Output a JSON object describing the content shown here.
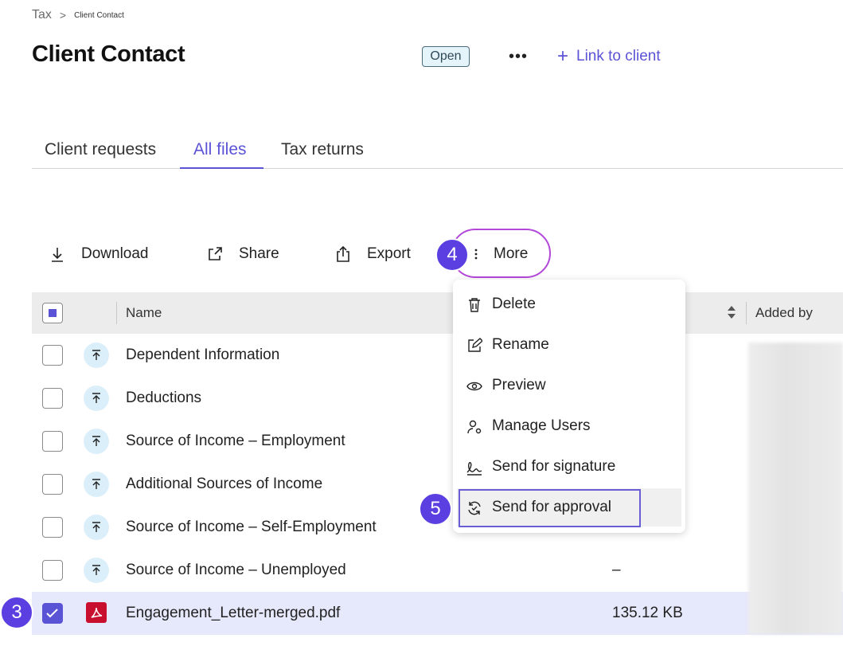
{
  "breadcrumb": {
    "root": "Tax",
    "separator": ">",
    "current": "Client Contact"
  },
  "page": {
    "title": "Client Contact",
    "status": "Open",
    "more_icon": "ellipsis-horizontal-icon",
    "link_label": "Link to client"
  },
  "tabs": [
    {
      "label": "Client requests",
      "active": false
    },
    {
      "label": "All files",
      "active": true
    },
    {
      "label": "Tax returns",
      "active": false
    }
  ],
  "toolbar": {
    "download": "Download",
    "share": "Share",
    "export": "Export",
    "more": "More"
  },
  "steps": {
    "more": "4",
    "approval": "5",
    "selected_row": "3"
  },
  "table": {
    "columns": {
      "name": "Name",
      "added_by": "Added by"
    },
    "rows": [
      {
        "name": "Dependent Information",
        "size": "",
        "icon": "upload-icon",
        "checked": false
      },
      {
        "name": "Deductions",
        "size": "",
        "icon": "upload-icon",
        "checked": false
      },
      {
        "name": "Source of Income – Employment",
        "size": "",
        "icon": "upload-icon",
        "checked": false
      },
      {
        "name": "Additional Sources of Income",
        "size": "",
        "icon": "upload-icon",
        "checked": false
      },
      {
        "name": "Source of Income – Self-Employment",
        "size": "",
        "icon": "upload-icon",
        "checked": false
      },
      {
        "name": "Source of Income – Unemployed",
        "size": "–",
        "icon": "upload-icon",
        "checked": false
      },
      {
        "name": "Engagement_Letter-merged.pdf",
        "size": "135.12 KB",
        "icon": "pdf-icon",
        "checked": true
      }
    ]
  },
  "menu": {
    "items": [
      {
        "label": "Delete",
        "icon": "trash-icon"
      },
      {
        "label": "Rename",
        "icon": "edit-icon"
      },
      {
        "label": "Preview",
        "icon": "eye-icon"
      },
      {
        "label": "Manage Users",
        "icon": "user-gear-icon"
      },
      {
        "label": "Send for signature",
        "icon": "signature-icon"
      },
      {
        "label": "Send for approval",
        "icon": "approval-icon"
      }
    ]
  },
  "colors": {
    "accent": "#5b53d6",
    "step_badge": "#5b3fe0",
    "highlight_oval": "#b347d9",
    "pdf_red": "#c8102e"
  }
}
